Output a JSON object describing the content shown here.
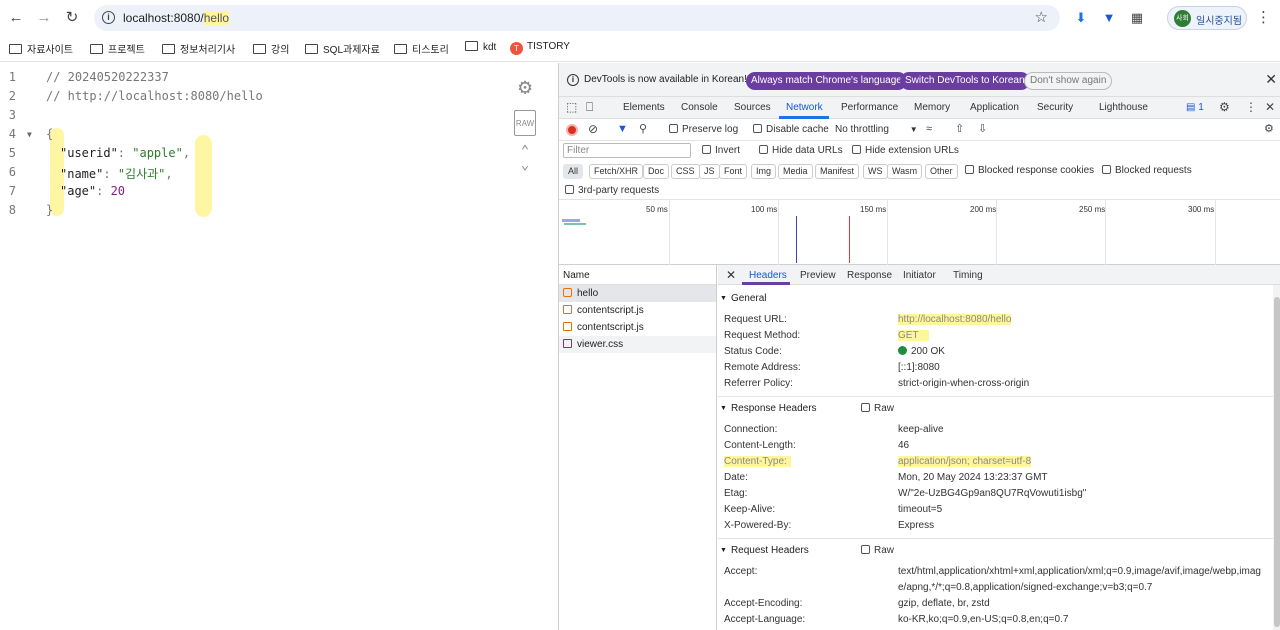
{
  "browser": {
    "url_host": "localhost:8080/",
    "url_path": "hello",
    "profile_label": "일시중지됨",
    "profile_initials": "사회"
  },
  "bookmarks": [
    "자료사이트",
    "프로젝트",
    "정보처리기사",
    "강의",
    "SQL과제자료",
    "티스토리",
    "kdt",
    "TISTORY"
  ],
  "viewer": {
    "lines": [
      "1",
      "2",
      "3",
      "4",
      "5",
      "6",
      "7",
      "8"
    ],
    "comment1": "// 20240520222337",
    "comment2": "// http://localhost:8080/hello",
    "open_brace": "{",
    "close_brace": "}",
    "key_userid": "\"userid\"",
    "val_userid": "\"apple\"",
    "key_name": "\"name\"",
    "val_name": "\"김사과\"",
    "key_age": "\"age\"",
    "val_age": "20",
    "raw_label": "RAW"
  },
  "devtools": {
    "infobar": {
      "text": "DevTools is now available in Korean!",
      "btn_match": "Always match Chrome's language",
      "btn_switch": "Switch DevTools to Korean",
      "btn_dismiss": "Don't show again"
    },
    "tabs": [
      "Elements",
      "Console",
      "Sources",
      "Network",
      "Performance",
      "Memory",
      "Application",
      "Security",
      "Lighthouse"
    ],
    "issues_count": "1",
    "network": {
      "preserve_log": "Preserve log",
      "disable_cache": "Disable cache",
      "throttling": "No throttling",
      "filter_placeholder": "Filter",
      "invert": "Invert",
      "hide_data_urls": "Hide data URLs",
      "hide_ext_urls": "Hide extension URLs",
      "types": [
        "All",
        "Fetch/XHR",
        "Doc",
        "CSS",
        "JS",
        "Font",
        "Img",
        "Media",
        "Manifest",
        "WS",
        "Wasm",
        "Other"
      ],
      "blocked_cookies": "Blocked response cookies",
      "blocked_requests": "Blocked requests",
      "third_party": "3rd-party requests",
      "ticks": [
        "50 ms",
        "100 ms",
        "150 ms",
        "200 ms",
        "250 ms",
        "300 ms"
      ],
      "name_header": "Name",
      "requests": [
        "hello",
        "contentscript.js",
        "contentscript.js",
        "viewer.css"
      ]
    },
    "detail_tabs": [
      "Headers",
      "Preview",
      "Response",
      "Initiator",
      "Timing"
    ],
    "general": {
      "title": "General",
      "rows": [
        {
          "k": "Request URL:",
          "v": "http://localhost:8080/hello"
        },
        {
          "k": "Request Method:",
          "v": "GET"
        },
        {
          "k": "Status Code:",
          "v": "200 OK"
        },
        {
          "k": "Remote Address:",
          "v": "[::1]:8080"
        },
        {
          "k": "Referrer Policy:",
          "v": "strict-origin-when-cross-origin"
        }
      ]
    },
    "response_headers": {
      "title": "Response Headers",
      "raw": "Raw",
      "rows": [
        {
          "k": "Connection:",
          "v": "keep-alive"
        },
        {
          "k": "Content-Length:",
          "v": "46"
        },
        {
          "k": "Content-Type:",
          "v": "application/json; charset=utf-8"
        },
        {
          "k": "Date:",
          "v": "Mon, 20 May 2024 13:23:37 GMT"
        },
        {
          "k": "Etag:",
          "v": "W/\"2e-UzBG4Gp9an8QU7RqVowuti1isbg\""
        },
        {
          "k": "Keep-Alive:",
          "v": "timeout=5"
        },
        {
          "k": "X-Powered-By:",
          "v": "Express"
        }
      ]
    },
    "request_headers": {
      "title": "Request Headers",
      "raw": "Raw",
      "rows": [
        {
          "k": "Accept:",
          "v": "text/html,application/xhtml+xml,application/xml;q=0.9,image/avif,image/webp,imag",
          "v2": "e/apng,*/*;q=0.8,application/signed-exchange;v=b3;q=0.7"
        },
        {
          "k": "Accept-Encoding:",
          "v": "gzip, deflate, br, zstd"
        },
        {
          "k": "Accept-Language:",
          "v": "ko-KR,ko;q=0.9,en-US;q=0.8,en;q=0.7"
        }
      ]
    }
  }
}
